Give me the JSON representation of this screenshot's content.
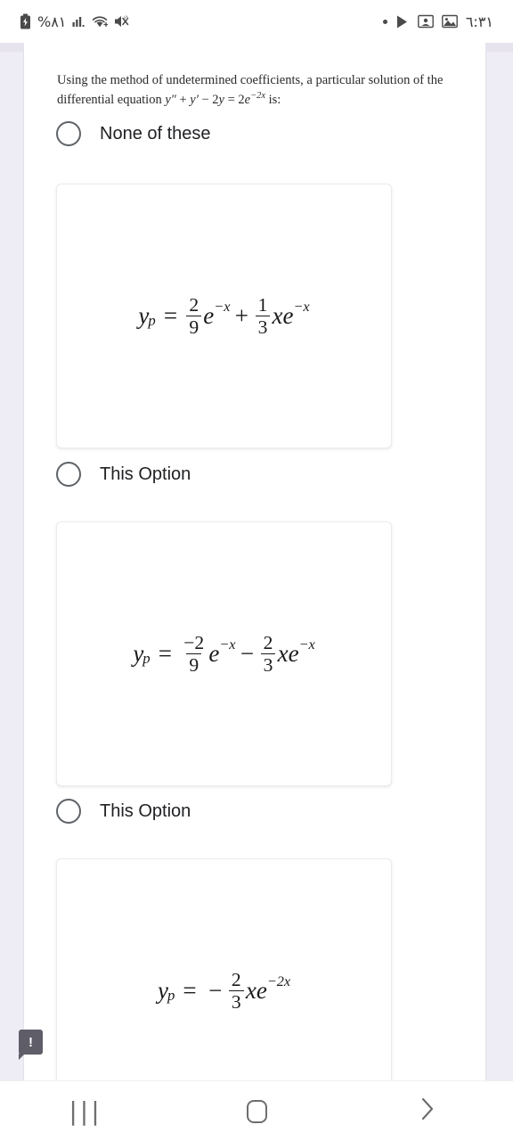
{
  "status_bar": {
    "battery_icon": "battery-charging-icon",
    "battery_percent": "%٨١",
    "signal_icon": "signal-bars-icon",
    "wifi_icon": "wifi-icon",
    "mute_icon": "volume-mute-icon",
    "dot": "notification-dot",
    "play_icon": "play-store-icon",
    "contacts_icon": "contacts-icon",
    "photos_icon": "photos-icon",
    "time": "٦:٣١"
  },
  "question": {
    "line1": "Using the method of undetermined coefficients, a particular solution of the",
    "line2_prefix": "differential equation ",
    "eq_y2": "y",
    "eq_prime2": "″",
    "eq_plus": " + ",
    "eq_y1": "y",
    "eq_prime1": "′",
    "eq_minus": " − 2",
    "eq_y3": "y",
    "eq_equals": " = 2",
    "eq_e": "e",
    "eq_exp": "−2x",
    "line2_suffix": " is:"
  },
  "options": [
    {
      "id": "none-of-these",
      "label": "None of these",
      "has_image": false
    },
    {
      "id": "option-1",
      "label": "This Option",
      "has_image": true,
      "formula": {
        "lhs_var": "y",
        "lhs_sub": "p",
        "equals": "=",
        "term1_num": "2",
        "term1_den": "9",
        "term1_base": "e",
        "term1_exp": "−x",
        "operator": "+",
        "term2_num": "1",
        "term2_den": "3",
        "term2_x": "x",
        "term2_base": "e",
        "term2_exp": "−x"
      },
      "formula_text": "y_p = (2/9)e^(-x) + (1/3)xe^(-x)"
    },
    {
      "id": "option-2",
      "label": "This Option",
      "has_image": true,
      "formula": {
        "lhs_var": "y",
        "lhs_sub": "p",
        "equals": "=",
        "term1_num": "−2",
        "term1_den": "9",
        "term1_base": "e",
        "term1_exp": "−x",
        "operator": "−",
        "term2_num": "2",
        "term2_den": "3",
        "term2_x": "x",
        "term2_base": "e",
        "term2_exp": "−x"
      },
      "formula_text": "y_p = (-2/9)e^(-x) - (2/3)xe^(-x)"
    },
    {
      "id": "option-3",
      "label": "",
      "has_image": true,
      "formula": {
        "lhs_var": "y",
        "lhs_sub": "p",
        "equals": "=",
        "lead_sign": "−",
        "term1_num": "2",
        "term1_den": "3",
        "term1_x": "x",
        "term1_base": "e",
        "term1_exp": "−2x"
      },
      "formula_text": "y_p = -(2/3)xe^(-2x)"
    }
  ],
  "tooltip_badge": {
    "icon": "alert-tooltip-icon",
    "symbol": "!"
  },
  "nav_bar": {
    "recents_label": "|||",
    "recents_icon": "recents-icon",
    "home_icon": "home-icon",
    "back_icon": "back-chevron-icon",
    "back_glyph": "›"
  },
  "colors": {
    "page_bg": "#ffffff",
    "edge_strip": "#eeecf4",
    "radio_border": "#5f6368",
    "text": "#202124",
    "tooltip_bg": "#5f5d68"
  }
}
